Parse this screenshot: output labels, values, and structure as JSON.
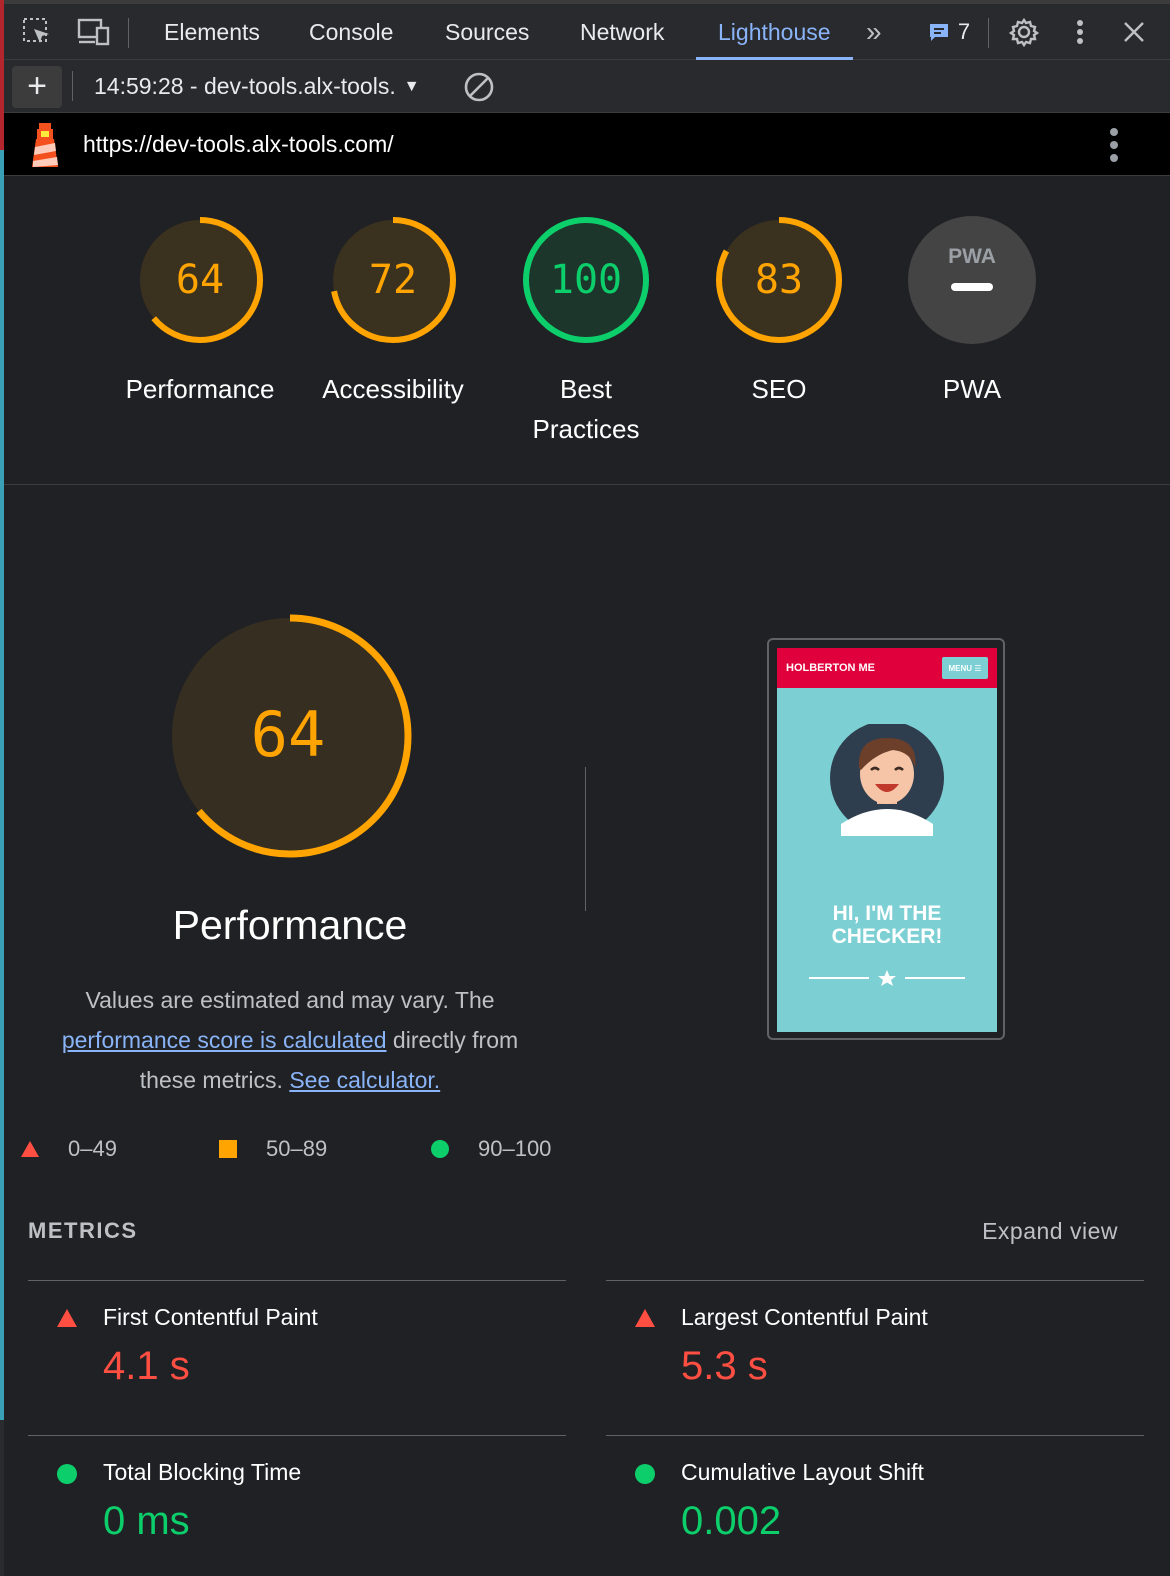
{
  "devtools": {
    "tabs": [
      "Elements",
      "Console",
      "Sources",
      "Network",
      "Lighthouse"
    ],
    "active_tab": "Lighthouse",
    "more_tabs_glyph": "»",
    "issues_count": "7"
  },
  "toolbar": {
    "new_report": "+",
    "report_selector": "14:59:28 - dev-tools.alx-tools.",
    "clear_icon": "block-icon"
  },
  "urlbar": {
    "url": "https://dev-tools.alx-tools.com/"
  },
  "categories": [
    {
      "label": "Performance",
      "score": "64",
      "value": 64,
      "color": "#ffa400"
    },
    {
      "label": "Accessibility",
      "score": "72",
      "value": 72,
      "color": "#ffa400"
    },
    {
      "label": "Best Practices",
      "score": "100",
      "value": 100,
      "color": "#0cce6b"
    },
    {
      "label": "SEO",
      "score": "83",
      "value": 83,
      "color": "#ffa400"
    },
    {
      "label": "PWA",
      "score": "PWA",
      "value": null,
      "color": "#9aa0a6"
    }
  ],
  "performance": {
    "score": "64",
    "value": 64,
    "title": "Performance",
    "desc_prefix": "Values are estimated and may vary. The ",
    "desc_link": "performance score is calculated",
    "desc_middle": " directly from these metrics. ",
    "desc_link2": "See calculator."
  },
  "legend": [
    {
      "range": "0–49",
      "color": "#ff4e42",
      "shape": "triangle"
    },
    {
      "range": "50–89",
      "color": "#ffa400",
      "shape": "square"
    },
    {
      "range": "90–100",
      "color": "#0cce6b",
      "shape": "circle"
    }
  ],
  "screenshot": {
    "brand": "HOLBERTON ME",
    "menu": "MENU ☰",
    "hero_line1": "HI, I'M THE",
    "hero_line2": "CHECKER!"
  },
  "metrics": {
    "heading": "METRICS",
    "expand": "Expand view",
    "items": [
      {
        "label": "First Contentful Paint",
        "value": "4.1 s",
        "status": "fail"
      },
      {
        "label": "Largest Contentful Paint",
        "value": "5.3 s",
        "status": "fail"
      },
      {
        "label": "Total Blocking Time",
        "value": "0 ms",
        "status": "pass"
      },
      {
        "label": "Cumulative Layout Shift",
        "value": "0.002",
        "status": "pass"
      }
    ]
  },
  "colors": {
    "average": "#ffa400",
    "pass": "#0cce6b",
    "fail": "#ff4e42",
    "link": "#8ab4f8"
  }
}
